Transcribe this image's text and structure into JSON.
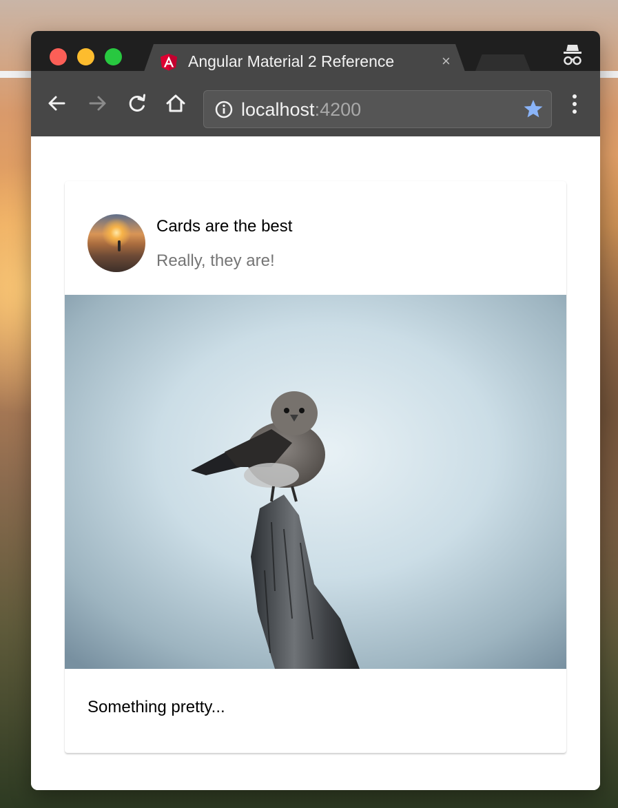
{
  "browser": {
    "tab_title": "Angular Material 2 Reference",
    "tab_close": "×",
    "url_host": "localhost",
    "url_port": ":4200"
  },
  "card": {
    "title": "Cards are the best",
    "subtitle": "Really, they are!",
    "content": "Something pretty..."
  },
  "icons": {
    "tab_favicon": "angular-logo-icon",
    "incognito": "incognito-icon",
    "back": "arrow-left-icon",
    "forward": "arrow-right-icon",
    "reload": "reload-icon",
    "home": "home-icon",
    "site_info": "info-icon",
    "bookmark": "star-icon",
    "menu": "kebab-menu-icon"
  },
  "colors": {
    "angular_red": "#dd0031",
    "bookmark_star": "#8ab4f8",
    "chrome_dark": "#474747"
  }
}
